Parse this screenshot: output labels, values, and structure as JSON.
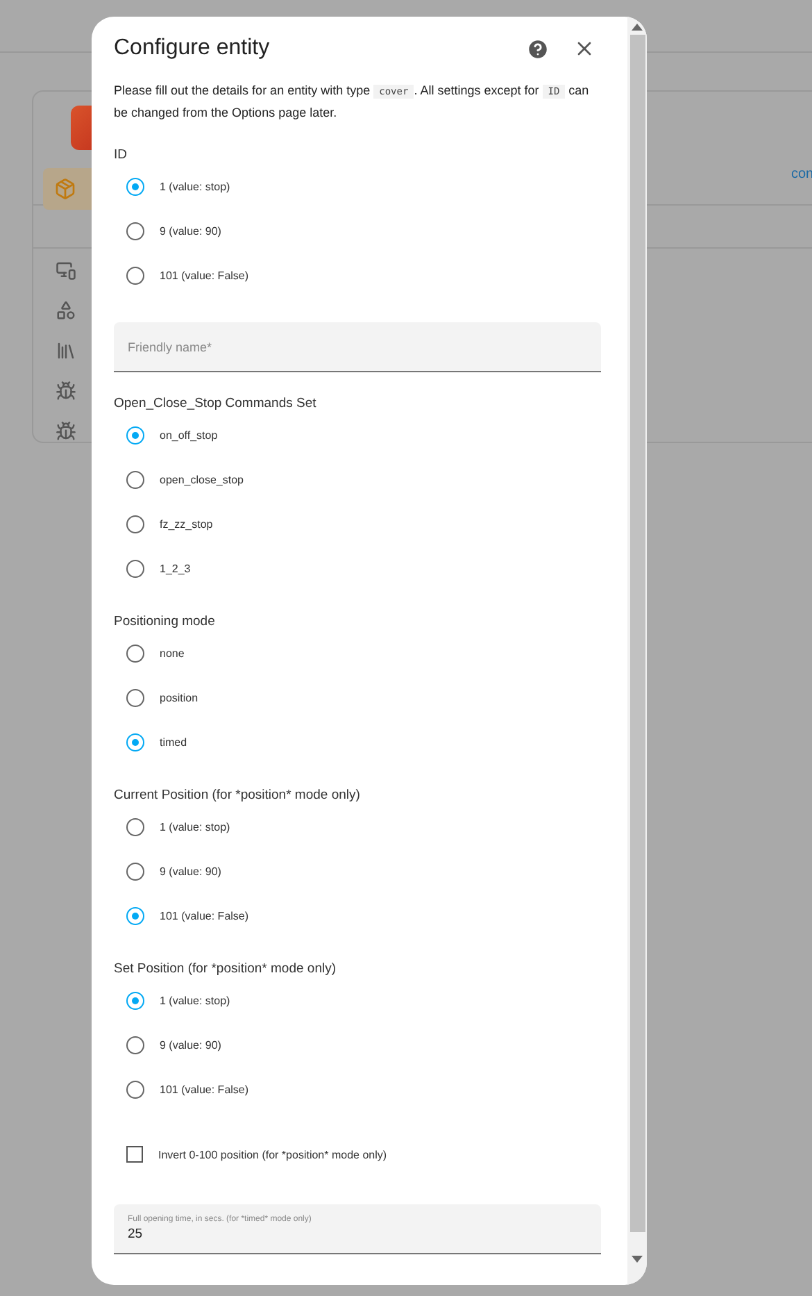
{
  "background": {
    "link": "con"
  },
  "dialog": {
    "title": "Configure entity",
    "description": [
      {
        "kind": "text",
        "text": "Please fill out the details for an entity with type "
      },
      {
        "kind": "code",
        "text": "cover"
      },
      {
        "kind": "text",
        "text": ". All settings except for "
      },
      {
        "kind": "code",
        "text": "ID"
      },
      {
        "kind": "text",
        "text": " can be changed from the Options page later."
      }
    ],
    "sections": [
      {
        "kind": "radio",
        "label": "ID",
        "options": [
          {
            "label": "1 (value: stop)",
            "selected": true
          },
          {
            "label": "9 (value: 90)",
            "selected": false
          },
          {
            "label": "101 (value: False)",
            "selected": false
          }
        ]
      },
      {
        "kind": "field",
        "placeholder": "Friendly name*"
      },
      {
        "kind": "radio",
        "label": "Open_Close_Stop Commands Set",
        "options": [
          {
            "label": "on_off_stop",
            "selected": true
          },
          {
            "label": "open_close_stop",
            "selected": false
          },
          {
            "label": "fz_zz_stop",
            "selected": false
          },
          {
            "label": "1_2_3",
            "selected": false
          }
        ]
      },
      {
        "kind": "radio",
        "label": "Positioning mode",
        "options": [
          {
            "label": "none",
            "selected": false
          },
          {
            "label": "position",
            "selected": false
          },
          {
            "label": "timed",
            "selected": true
          }
        ]
      },
      {
        "kind": "radio",
        "label": "Current Position (for *position* mode only)",
        "options": [
          {
            "label": "1 (value: stop)",
            "selected": false
          },
          {
            "label": "9 (value: 90)",
            "selected": false
          },
          {
            "label": "101 (value: False)",
            "selected": true
          }
        ]
      },
      {
        "kind": "radio",
        "label": "Set Position (for *position* mode only)",
        "options": [
          {
            "label": "1 (value: stop)",
            "selected": true
          },
          {
            "label": "9 (value: 90)",
            "selected": false
          },
          {
            "label": "101 (value: False)",
            "selected": false
          }
        ]
      },
      {
        "kind": "checkbox",
        "label": "Invert 0-100 position (for *position* mode only)",
        "checked": false
      },
      {
        "kind": "field",
        "label": "Full opening time, in secs. (for *timed* mode only)",
        "value": "25"
      }
    ]
  }
}
